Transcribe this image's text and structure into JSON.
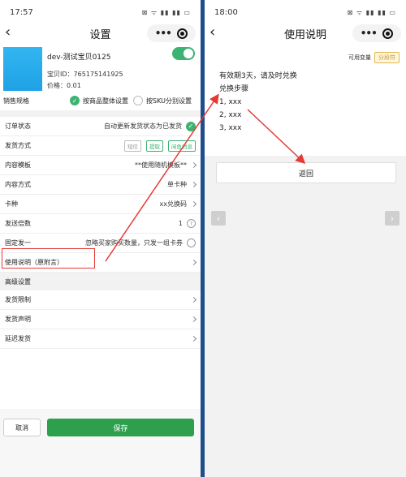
{
  "left": {
    "status": {
      "time": "17:57",
      "icons": "⊠ ᯤ ▮▮ ▮▮ ▭"
    },
    "nav": {
      "title": "设置",
      "back": "‹",
      "dots": "•••"
    },
    "product": {
      "name": "dev-测试宝贝0125",
      "id": "宝贝ID：765175141925",
      "price": "价格：0.01"
    },
    "spec": {
      "label": "销售规格",
      "opt1": "按商品整体设置",
      "opt2": "按SKU分别设置"
    },
    "rows": {
      "order_status": {
        "k": "订单状态",
        "v": "自动更新发货状态为已发货"
      },
      "ship_method": {
        "k": "发货方式",
        "tag1": "短信",
        "tag2": "提取",
        "tag3": "闲鱼消息"
      },
      "content_tpl": {
        "k": "内容模板",
        "v": "**使用随机模板**"
      },
      "content_method": {
        "k": "内容方式",
        "v": "单卡种"
      },
      "card_type": {
        "k": "卡种",
        "v": "xx兑换码"
      },
      "ship_multiple": {
        "k": "发送倍数",
        "v": "1",
        "q": "?"
      },
      "fixed_one": {
        "k": "固定发一",
        "v": "忽略买家购买数量，只发一组卡券"
      },
      "usage": {
        "k": "使用说明（原附言）"
      }
    },
    "advanced": {
      "title": "高级设置",
      "limit": "发货限制",
      "statement": "发货声明",
      "delay": "延迟发货"
    },
    "footer": {
      "cancel": "取消",
      "save": "保存"
    }
  },
  "right": {
    "status": {
      "time": "18:00",
      "icons": "⊠ ᯤ ▮▮ ▮▮ ▭"
    },
    "nav": {
      "title": "使用说明",
      "back": "‹",
      "dots": "•••"
    },
    "badges": {
      "avail": "可用变量",
      "group": "分段符"
    },
    "content": {
      "line1": "有效期3天，请及时兑换",
      "line2": "兑换步骤",
      "line3": "1, xxx",
      "line4": "2, xxx",
      "line5": "3, xxx"
    },
    "return_label": "返回",
    "prev": "‹",
    "next": "›"
  },
  "colors": {
    "accent": "#2da04d",
    "annotation": "#e53935",
    "divider": "#1f4e8c"
  }
}
